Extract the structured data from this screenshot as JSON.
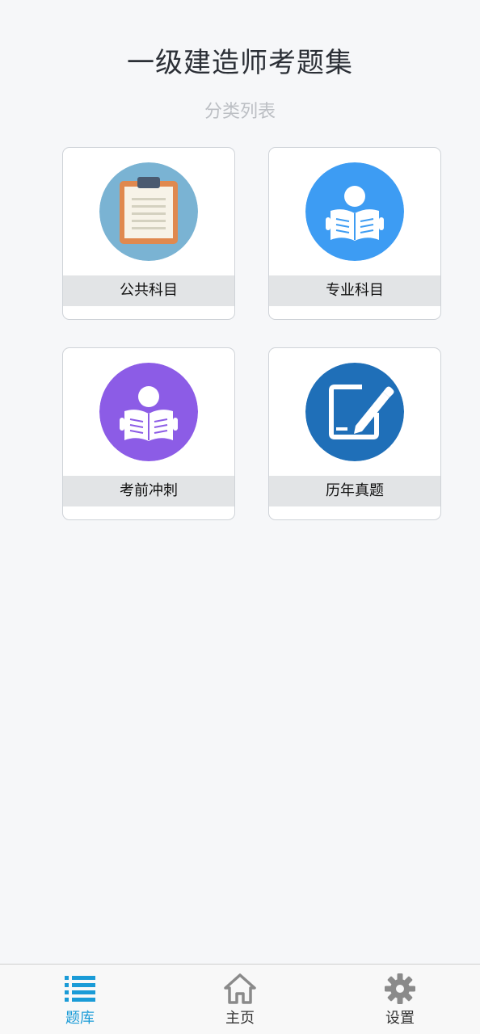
{
  "header": {
    "title": "一级建造师考题集",
    "subtitle": "分类列表"
  },
  "categories": [
    {
      "label": "公共科目",
      "icon": "clipboard-icon",
      "color": "#7ab3d3"
    },
    {
      "label": "专业科目",
      "icon": "reading-person-icon",
      "color": "#3d9cf3"
    },
    {
      "label": "考前冲刺",
      "icon": "reading-person-icon",
      "color": "#8c5ce6"
    },
    {
      "label": "历年真题",
      "icon": "edit-pen-icon",
      "color": "#1f6fb8"
    }
  ],
  "tabbar": {
    "items": [
      {
        "label": "题库",
        "icon": "list-icon",
        "active": true
      },
      {
        "label": "主页",
        "icon": "home-icon",
        "active": false
      },
      {
        "label": "设置",
        "icon": "gear-icon",
        "active": false
      }
    ],
    "active_color": "#1a9bd7"
  }
}
